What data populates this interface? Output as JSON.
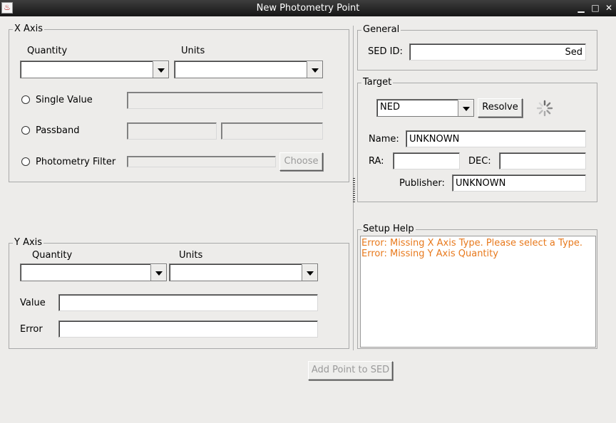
{
  "window": {
    "title": "New Photometry Point"
  },
  "x_axis": {
    "title": "X Axis",
    "quantity_label": "Quantity",
    "units_label": "Units",
    "quantity_value": "",
    "units_value": "",
    "single_value_label": "Single Value",
    "passband_label": "Passband",
    "photometry_filter_label": "Photometry Filter",
    "choose_label": "Choose"
  },
  "y_axis": {
    "title": "Y Axis",
    "quantity_label": "Quantity",
    "units_label": "Units",
    "quantity_value": "",
    "units_value": "",
    "value_label": "Value",
    "error_label": "Error",
    "value_value": "",
    "error_value": ""
  },
  "general": {
    "title": "General",
    "sed_id_label": "SED ID:",
    "sed_id_value": "Sed"
  },
  "target": {
    "title": "Target",
    "catalog_value": "NED",
    "resolve_label": "Resolve",
    "name_label": "Name:",
    "name_value": "UNKNOWN",
    "ra_label": "RA:",
    "ra_value": "",
    "dec_label": "DEC:",
    "dec_value": "",
    "publisher_label": "Publisher:",
    "publisher_value": "UNKNOWN"
  },
  "setup_help": {
    "title": "Setup Help",
    "messages": [
      "Error: Missing X Axis Type. Please select a Type.",
      "Error: Missing Y Axis Quantity"
    ],
    "message_color": "#e8791c"
  },
  "footer": {
    "add_point_label": "Add Point to SED"
  },
  "icons": {
    "app": "java-app-icon",
    "minimize": "minimize-icon",
    "maximize": "maximize-icon",
    "close": "close-icon",
    "busy": "spinner-icon"
  }
}
